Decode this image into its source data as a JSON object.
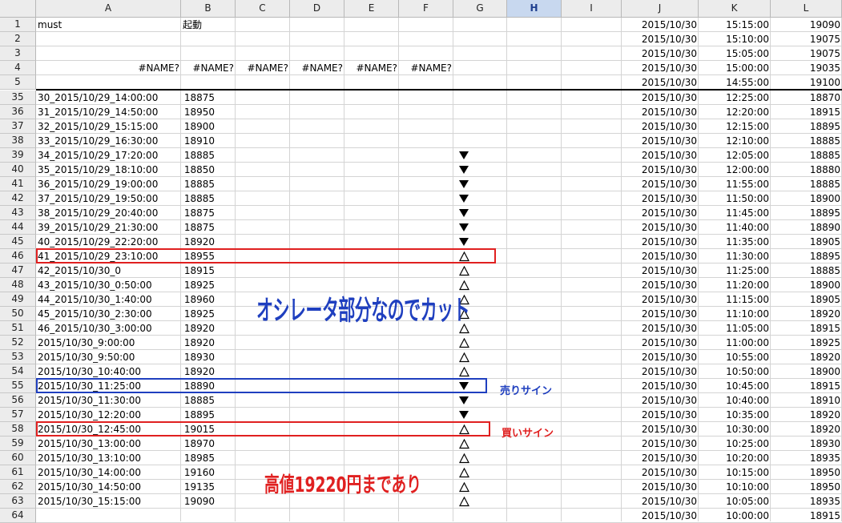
{
  "columns": [
    "A",
    "B",
    "C",
    "D",
    "E",
    "F",
    "G",
    "H",
    "I",
    "J",
    "K",
    "L"
  ],
  "selected_column": "H",
  "top_rows": [
    {
      "num": "1",
      "A": "must",
      "B": "起動",
      "J": "2015/10/30",
      "K": "15:15:00",
      "L": "19090"
    },
    {
      "num": "2",
      "J": "2015/10/30",
      "K": "15:10:00",
      "L": "19075"
    },
    {
      "num": "3",
      "J": "2015/10/30",
      "K": "15:05:00",
      "L": "19075"
    },
    {
      "num": "4",
      "A": "#NAME?",
      "B": "#NAME?",
      "C": "#NAME?",
      "D": "#NAME?",
      "E": "#NAME?",
      "F": "#NAME?",
      "J": "2015/10/30",
      "K": "15:00:00",
      "L": "19035"
    },
    {
      "num": "5",
      "J": "2015/10/30",
      "K": "14:55:00",
      "L": "19100"
    }
  ],
  "rows": [
    {
      "num": "35",
      "A": "30_2015/10/29_14:00:00",
      "B": "18875",
      "G": "",
      "J": "2015/10/30",
      "K": "12:25:00",
      "L": "18870"
    },
    {
      "num": "36",
      "A": "31_2015/10/29_14:50:00",
      "B": "18950",
      "G": "",
      "J": "2015/10/30",
      "K": "12:20:00",
      "L": "18915"
    },
    {
      "num": "37",
      "A": "32_2015/10/29_15:15:00",
      "B": "18900",
      "G": "",
      "J": "2015/10/30",
      "K": "12:15:00",
      "L": "18895"
    },
    {
      "num": "38",
      "A": "33_2015/10/29_16:30:00",
      "B": "18910",
      "G": "",
      "J": "2015/10/30",
      "K": "12:10:00",
      "L": "18885"
    },
    {
      "num": "39",
      "A": "34_2015/10/29_17:20:00",
      "B": "18885",
      "G": "▼",
      "J": "2015/10/30",
      "K": "12:05:00",
      "L": "18885"
    },
    {
      "num": "40",
      "A": "35_2015/10/29_18:10:00",
      "B": "18850",
      "G": "▼",
      "J": "2015/10/30",
      "K": "12:00:00",
      "L": "18880"
    },
    {
      "num": "41",
      "A": "36_2015/10/29_19:00:00",
      "B": "18885",
      "G": "▼",
      "J": "2015/10/30",
      "K": "11:55:00",
      "L": "18885"
    },
    {
      "num": "42",
      "A": "37_2015/10/29_19:50:00",
      "B": "18885",
      "G": "▼",
      "J": "2015/10/30",
      "K": "11:50:00",
      "L": "18900"
    },
    {
      "num": "43",
      "A": "38_2015/10/29_20:40:00",
      "B": "18875",
      "G": "▼",
      "J": "2015/10/30",
      "K": "11:45:00",
      "L": "18895"
    },
    {
      "num": "44",
      "A": "39_2015/10/29_21:30:00",
      "B": "18875",
      "G": "▼",
      "J": "2015/10/30",
      "K": "11:40:00",
      "L": "18890"
    },
    {
      "num": "45",
      "A": "40_2015/10/29_22:20:00",
      "B": "18920",
      "G": "▼",
      "J": "2015/10/30",
      "K": "11:35:00",
      "L": "18905"
    },
    {
      "num": "46",
      "A": "41_2015/10/29_23:10:00",
      "B": "18955",
      "G": "△",
      "J": "2015/10/30",
      "K": "11:30:00",
      "L": "18895"
    },
    {
      "num": "47",
      "A": "42_2015/10/30_0",
      "B": "18915",
      "G": "△",
      "J": "2015/10/30",
      "K": "11:25:00",
      "L": "18885"
    },
    {
      "num": "48",
      "A": "43_2015/10/30_0:50:00",
      "B": "18925",
      "G": "△",
      "J": "2015/10/30",
      "K": "11:20:00",
      "L": "18900"
    },
    {
      "num": "49",
      "A": "44_2015/10/30_1:40:00",
      "B": "18960",
      "G": "△",
      "J": "2015/10/30",
      "K": "11:15:00",
      "L": "18905"
    },
    {
      "num": "50",
      "A": "45_2015/10/30_2:30:00",
      "B": "18925",
      "G": "△",
      "J": "2015/10/30",
      "K": "11:10:00",
      "L": "18920"
    },
    {
      "num": "51",
      "A": "46_2015/10/30_3:00:00",
      "B": "18920",
      "G": "△",
      "J": "2015/10/30",
      "K": "11:05:00",
      "L": "18915"
    },
    {
      "num": "52",
      "A": "2015/10/30_9:00:00",
      "B": "18920",
      "G": "△",
      "J": "2015/10/30",
      "K": "11:00:00",
      "L": "18925"
    },
    {
      "num": "53",
      "A": "2015/10/30_9:50:00",
      "B": "18930",
      "G": "△",
      "J": "2015/10/30",
      "K": "10:55:00",
      "L": "18920"
    },
    {
      "num": "54",
      "A": "2015/10/30_10:40:00",
      "B": "18920",
      "G": "△",
      "J": "2015/10/30",
      "K": "10:50:00",
      "L": "18900"
    },
    {
      "num": "55",
      "A": "2015/10/30_11:25:00",
      "B": "18890",
      "G": "▼",
      "J": "2015/10/30",
      "K": "10:45:00",
      "L": "18915"
    },
    {
      "num": "56",
      "A": "2015/10/30_11:30:00",
      "B": "18885",
      "G": "▼",
      "J": "2015/10/30",
      "K": "10:40:00",
      "L": "18910"
    },
    {
      "num": "57",
      "A": "2015/10/30_12:20:00",
      "B": "18895",
      "G": "▼",
      "J": "2015/10/30",
      "K": "10:35:00",
      "L": "18920"
    },
    {
      "num": "58",
      "A": "2015/10/30_12:45:00",
      "B": "19015",
      "G": "△",
      "J": "2015/10/30",
      "K": "10:30:00",
      "L": "18920"
    },
    {
      "num": "59",
      "A": "2015/10/30_13:00:00",
      "B": "18970",
      "G": "△",
      "J": "2015/10/30",
      "K": "10:25:00",
      "L": "18930"
    },
    {
      "num": "60",
      "A": "2015/10/30_13:10:00",
      "B": "18985",
      "G": "△",
      "J": "2015/10/30",
      "K": "10:20:00",
      "L": "18935"
    },
    {
      "num": "61",
      "A": "2015/10/30_14:00:00",
      "B": "19160",
      "G": "△",
      "J": "2015/10/30",
      "K": "10:15:00",
      "L": "18950"
    },
    {
      "num": "62",
      "A": "2015/10/30_14:50:00",
      "B": "19135",
      "G": "△",
      "J": "2015/10/30",
      "K": "10:10:00",
      "L": "18950"
    },
    {
      "num": "63",
      "A": "2015/10/30_15:15:00",
      "B": "19090",
      "G": "△",
      "J": "2015/10/30",
      "K": "10:05:00",
      "L": "18935"
    },
    {
      "num": "64",
      "A": "",
      "B": "",
      "G": "",
      "J": "2015/10/30",
      "K": "10:00:00",
      "L": "18915"
    }
  ],
  "annotations": {
    "oscillator_note": "オシレータ部分なのでカット",
    "sell_sign": "売りサイン",
    "buy_sign": "買いサイン",
    "high_note": "高値19220円まであり"
  },
  "colors": {
    "header_bg": "#ececec",
    "selected_header_bg": "#c8d8ef",
    "red_box": "#e02020",
    "blue_box": "#1f3fbf",
    "note_blue": "#1f3fbf",
    "note_red": "#e02020"
  }
}
